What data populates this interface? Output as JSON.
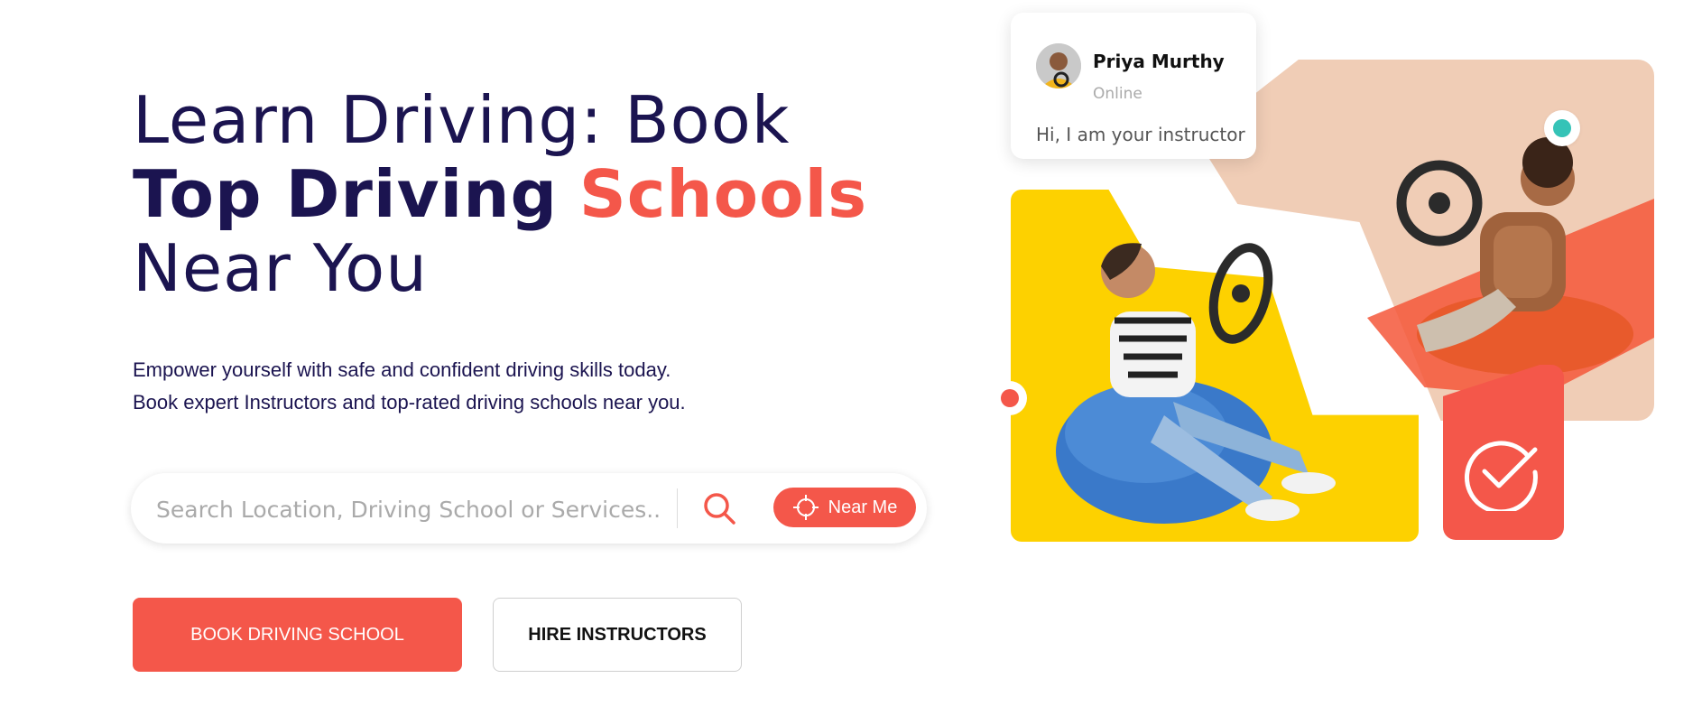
{
  "hero": {
    "title_line1": "Learn Driving: Book",
    "title_line2_bold": "Top Driving",
    "title_line2_accent": "Schools",
    "title_line3": "Near You",
    "subtitle_line1": "Empower yourself with safe and confident driving skills today.",
    "subtitle_line2": "Book expert Instructors and top-rated driving schools near you."
  },
  "search": {
    "placeholder": "Search Location, Driving School or Services...",
    "near_me_label": "Near Me",
    "search_icon": "search-icon",
    "locate_icon": "crosshair-icon"
  },
  "actions": {
    "primary_label": "BOOK DRIVING SCHOOL",
    "secondary_label": "HIRE INSTRUCTORS"
  },
  "chat": {
    "name": "Priya Murthy",
    "status": "Online",
    "message": "Hi, I am your instructor"
  },
  "colors": {
    "brand_navy": "#1b1450",
    "accent_red": "#f4574a",
    "yellow": "#fdd100",
    "teal": "#35c3b7",
    "tan": "#f0cdb6"
  }
}
